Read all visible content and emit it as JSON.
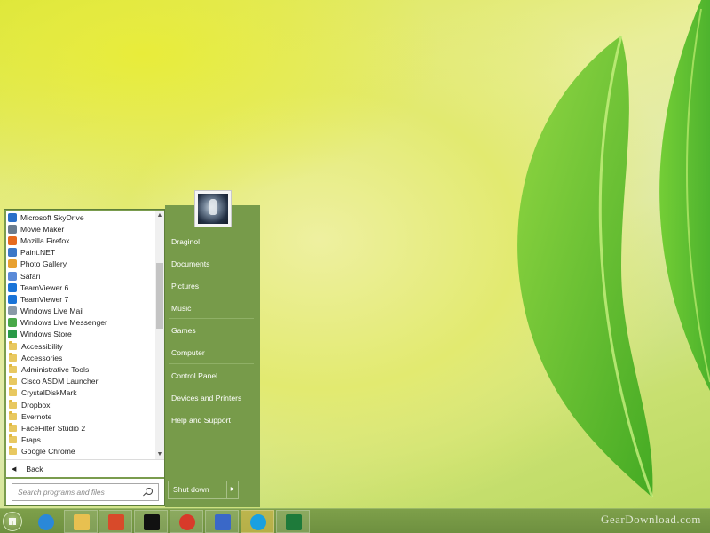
{
  "programs": [
    {
      "label": "Microsoft SkyDrive",
      "icon": "skydrive-icon",
      "color": "#2a6fc9"
    },
    {
      "label": "Movie Maker",
      "icon": "movie-maker-icon",
      "color": "#6a7c8e"
    },
    {
      "label": "Mozilla Firefox",
      "icon": "firefox-icon",
      "color": "#e66a1e"
    },
    {
      "label": "Paint.NET",
      "icon": "paintnet-icon",
      "color": "#3c78c8"
    },
    {
      "label": "Photo Gallery",
      "icon": "photo-gallery-icon",
      "color": "#e8a030"
    },
    {
      "label": "Safari",
      "icon": "safari-icon",
      "color": "#5a8ad8"
    },
    {
      "label": "TeamViewer 6",
      "icon": "teamviewer-icon",
      "color": "#1a74d8"
    },
    {
      "label": "TeamViewer 7",
      "icon": "teamviewer-icon",
      "color": "#1a74d8"
    },
    {
      "label": "Windows Live Mail",
      "icon": "live-mail-icon",
      "color": "#8a9aa8"
    },
    {
      "label": "Windows Live Messenger",
      "icon": "messenger-icon",
      "color": "#48a848"
    },
    {
      "label": "Windows Store",
      "icon": "store-icon",
      "color": "#2a9a48"
    },
    {
      "label": "Accessibility",
      "icon": "folder-icon"
    },
    {
      "label": "Accessories",
      "icon": "folder-icon"
    },
    {
      "label": "Administrative Tools",
      "icon": "folder-icon"
    },
    {
      "label": "Cisco ASDM Launcher",
      "icon": "folder-icon"
    },
    {
      "label": "CrystalDiskMark",
      "icon": "folder-icon"
    },
    {
      "label": "Dropbox",
      "icon": "folder-icon"
    },
    {
      "label": "Evernote",
      "icon": "folder-icon"
    },
    {
      "label": "FaceFilter Studio 2",
      "icon": "folder-icon"
    },
    {
      "label": "Fraps",
      "icon": "folder-icon"
    },
    {
      "label": "Google Chrome",
      "icon": "folder-icon"
    }
  ],
  "back_label": "Back",
  "search": {
    "placeholder": "Search programs and files"
  },
  "right_items": [
    {
      "label": "Draginol",
      "name": "user-folder-link"
    },
    {
      "label": "Documents",
      "name": "documents-link"
    },
    {
      "label": "Pictures",
      "name": "pictures-link"
    },
    {
      "label": "Music",
      "name": "music-link"
    },
    {
      "label": "Games",
      "name": "games-link"
    },
    {
      "label": "Computer",
      "name": "computer-link"
    },
    {
      "label": "Control Panel",
      "name": "control-panel-link"
    },
    {
      "label": "Devices and Printers",
      "name": "devices-printers-link"
    },
    {
      "label": "Help and Support",
      "name": "help-support-link"
    }
  ],
  "shutdown_label": "Shut down",
  "taskbar": [
    {
      "name": "internet-explorer-icon",
      "color": "#2a88d8"
    },
    {
      "name": "file-explorer-icon",
      "color": "#e8c050"
    },
    {
      "name": "app-butterfly-icon",
      "color": "#d84a2a"
    },
    {
      "name": "command-prompt-icon",
      "color": "#111111"
    },
    {
      "name": "chrome-icon",
      "color": "#d83a2a"
    },
    {
      "name": "paint-brush-icon",
      "color": "#3a68c8"
    },
    {
      "name": "skype-icon",
      "color": "#1aa0e0"
    },
    {
      "name": "excel-icon",
      "color": "#1e7a3a"
    }
  ],
  "watermark": "GearDownload.com"
}
